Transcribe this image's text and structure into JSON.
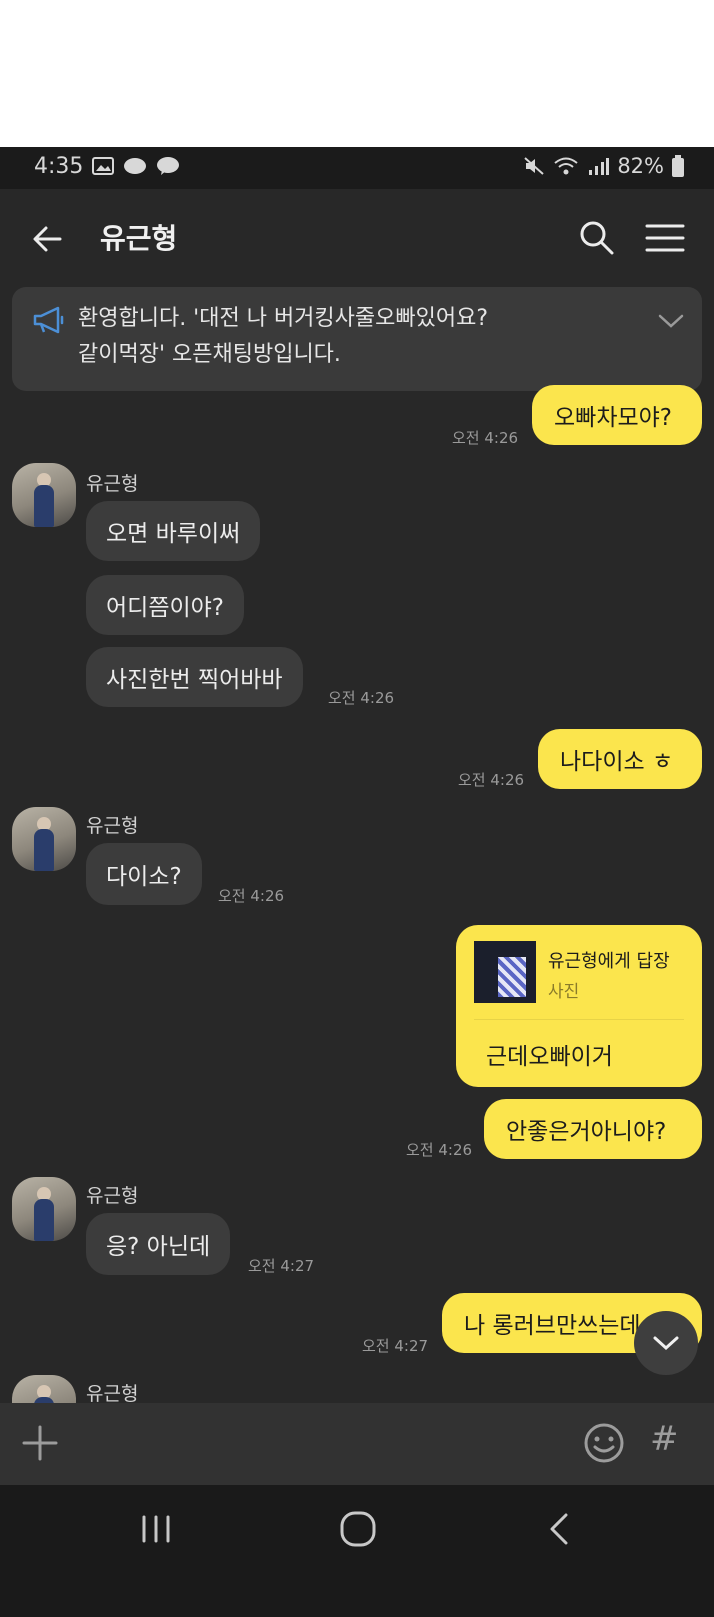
{
  "status_bar": {
    "time": "4:35",
    "battery": "82%"
  },
  "header": {
    "title": "유근형"
  },
  "notice": {
    "text_line1": "환영합니다. '대전 나 버거킹사줄오빠있어요?",
    "text_line2": "같이먹장' 오픈채팅방입니다."
  },
  "messages": {
    "m1": {
      "text": "오빠차모야?",
      "time": "오전 4:26"
    },
    "g1": {
      "sender": "유근형",
      "b1": "오면 바루이써",
      "b2": "어디쯤이야?",
      "b3": "사진한번 찍어바바",
      "time": "오전 4:26"
    },
    "m2": {
      "text": "나다이소 ㅎ",
      "time": "오전 4:26"
    },
    "g2": {
      "sender": "유근형",
      "b1": "다이소?",
      "time": "오전 4:26"
    },
    "reply": {
      "title": "유근형에게 답장",
      "subtitle": "사진",
      "body": "근데오빠이거"
    },
    "m3": {
      "text": "안좋은거아니야?",
      "time": "오전 4:26"
    },
    "g3": {
      "sender": "유근형",
      "b1": "응? 아닌데",
      "time": "오전 4:27"
    },
    "m4": {
      "text": "나 롱러브만쓰는데ㅡ",
      "time": "오전 4:27"
    },
    "g4": {
      "sender": "유근형"
    }
  },
  "input_bar": {
    "hash": "#"
  },
  "colors": {
    "accent": "#fbe54d",
    "background": "#282828",
    "bubble_in": "#3c3c3c"
  }
}
